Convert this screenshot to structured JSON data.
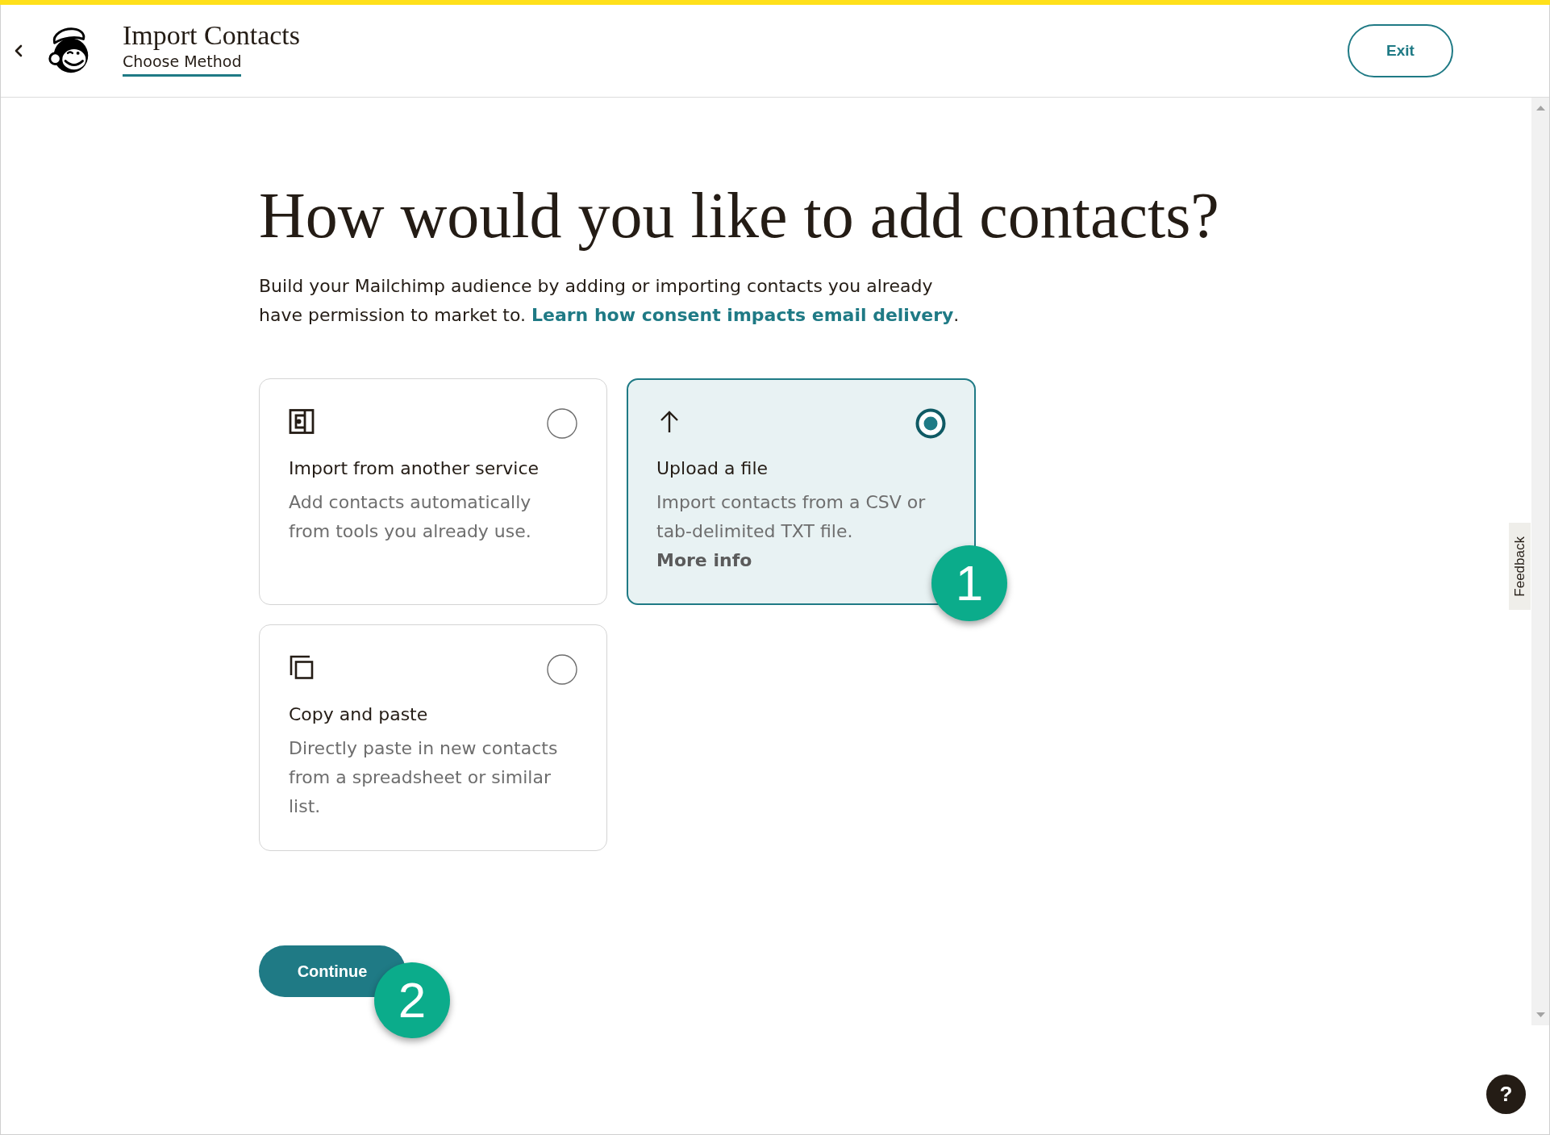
{
  "header": {
    "title": "Import Contacts",
    "step": "Choose Method",
    "exit": "Exit"
  },
  "intro": {
    "heading": "How would you like to add contacts?",
    "text": "Build your Mailchimp audience by adding or importing contacts you already have permission to market to.",
    "link": "Learn how consent impacts email delivery",
    "after_link": "."
  },
  "methods": [
    {
      "kind": "import",
      "title": "Import from another service",
      "description": "Add contacts automatically from tools you already use.",
      "selected": false
    },
    {
      "kind": "upload",
      "title": "Upload a file",
      "description": "Import contacts from a CSV or tab-delimited TXT file.",
      "link": "More info",
      "selected": true
    },
    {
      "kind": "paste",
      "title": "Copy and paste",
      "description": "Directly paste in new contacts from a spreadsheet or similar list.",
      "selected": false
    }
  ],
  "continue_button": "Continue",
  "feedback_tab": "Feedback",
  "help_button": "?",
  "annotations": [
    {
      "label": "1"
    },
    {
      "label": "2"
    }
  ]
}
